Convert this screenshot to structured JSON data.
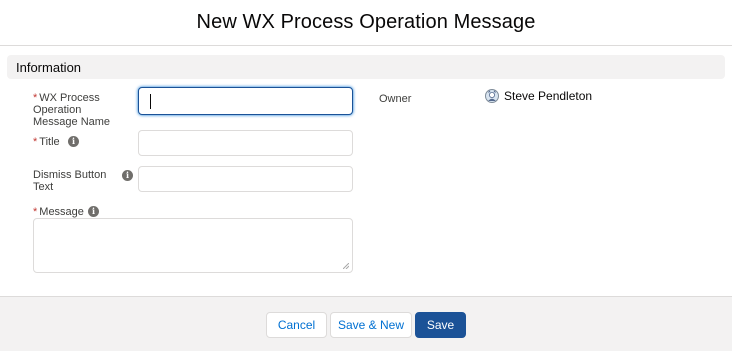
{
  "modal": {
    "title": "New WX Process Operation Message"
  },
  "section": {
    "title": "Information"
  },
  "fields": {
    "name": {
      "required_marker": "*",
      "label": "WX Process Operation Message Name",
      "value": ""
    },
    "title": {
      "required_marker": "*",
      "label": "Title",
      "value": "",
      "help_icon": "info-icon"
    },
    "dismiss": {
      "label": "Dismiss Button Text",
      "value": "",
      "help_icon": "info-icon"
    },
    "message": {
      "required_marker": "*",
      "label": "Message",
      "value": "",
      "help_icon": "info-icon"
    }
  },
  "owner": {
    "label": "Owner",
    "name": "Steve Pendleton",
    "avatar_icon": "user-avatar-icon"
  },
  "footer": {
    "cancel_label": "Cancel",
    "save_new_label": "Save & New",
    "save_label": "Save"
  },
  "colors": {
    "brand": "#1b5297",
    "link": "#0070d2",
    "required": "#c23934",
    "section_bg": "#f3f2f2"
  }
}
